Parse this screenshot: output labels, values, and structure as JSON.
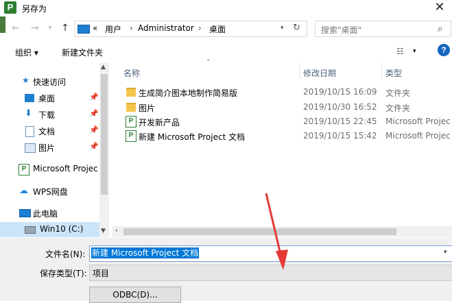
{
  "window": {
    "title": "另存为",
    "app_icon": "P"
  },
  "address": {
    "crumbs": [
      "«",
      "用户",
      "Administrator",
      "桌面"
    ],
    "search_placeholder": "搜索\"桌面\""
  },
  "toolbar": {
    "organize": "组织 ▾",
    "new_folder": "新建文件夹",
    "help": "?"
  },
  "nav": {
    "quick_access": "快速访问",
    "items": [
      {
        "label": "桌面",
        "pinned": true
      },
      {
        "label": "下载",
        "pinned": true
      },
      {
        "label": "文档",
        "pinned": true
      },
      {
        "label": "图片",
        "pinned": true
      }
    ],
    "ms_project": "Microsoft Projec",
    "wps": "WPS网盘",
    "this_pc": "此电脑",
    "drive": "Win10 (C:)"
  },
  "columns": {
    "name": "名称",
    "date": "修改日期",
    "type": "类型"
  },
  "files": [
    {
      "name": "生成简介图本地制作简易版",
      "date": "2019/10/15 16:09",
      "type": "文件夹",
      "icon": "folder-icon"
    },
    {
      "name": "图片",
      "date": "2019/10/30 16:52",
      "type": "文件夹",
      "icon": "folder-icon"
    },
    {
      "name": "开发新产品",
      "date": "2019/10/15 22:45",
      "type": "Microsoft Projec",
      "icon": "project-file-icon"
    },
    {
      "name": "新建 Microsoft Project 文档",
      "date": "2019/10/15 15:42",
      "type": "Microsoft Projec",
      "icon": "project-file-icon"
    }
  ],
  "form": {
    "filename_label": "文件名(N):",
    "filename_value": "新建 Microsoft Project 文档",
    "savetype_label": "保存类型(T):",
    "savetype_value": "项目",
    "odbc_button": "ODBC(D)..."
  },
  "colors": {
    "accent": "#0078d7",
    "annotation": "#e53935",
    "project_green": "#2e7d32",
    "folder": "#f3c64b"
  }
}
